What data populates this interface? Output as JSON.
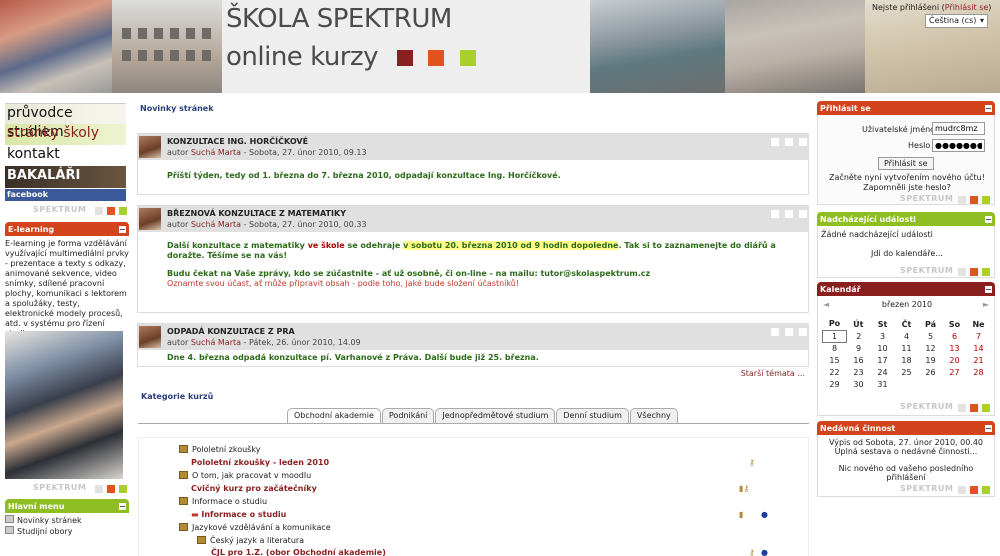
{
  "header": {
    "brand_line1": "ŠKOLA SPEKTRUM",
    "brand_line2": "online kurzy",
    "login_prefix": "Nejste přihlášeni (",
    "login_link": "Přihlásit se",
    "login_suffix": ")",
    "language": "Čeština (cs)",
    "colors": {
      "sq1": "#8a1f1f",
      "sq2": "#e2531f",
      "sq3": "#a9cf2c"
    }
  },
  "left": {
    "nav": [
      "průvodce studiem",
      "stránky školy",
      "kontakt",
      "BAKALÁŘI",
      "facebook"
    ],
    "spectrum": "SPEKTRUM",
    "elearning_title": "E-learning",
    "elearning_text": "E-learning je forma vzdělávání využívající multimediální prvky - prezentace a texty s odkazy, animované sekvence, video snímky, sdílené pracovní plochy, komunikaci s lektorem a spolužáky, testy, elektronické modely procesů, atd. v systému pro řízení studia.",
    "mainmenu_title": "Hlavní menu",
    "mainmenu_items": [
      "Novinky stránek",
      "Studijní obory"
    ]
  },
  "main": {
    "news_title": "Novinky stránek",
    "posts": [
      {
        "title": "KONZULTACE ING. HORČÍČKOVÉ",
        "by": "autor",
        "author": "Suchá Marta",
        "date": " - Sobota, 27. únor 2010, 09.13",
        "body": "Příští týden, tedy od 1. března do 7. března 2010, odpadají konzultace Ing. Horčíčkové."
      },
      {
        "title": "BŘEZNOVÁ KONZULTACE Z MATEMATIKY",
        "by": "autor",
        "author": "Suchá Marta",
        "date": " - Sobota, 27. únor 2010, 00.33",
        "body_a": "Další konzultace z matematiky ",
        "body_b": "ve škole",
        "body_c": " se odehraje ",
        "body_d": "v sobotu 20. března 2010 od 9 hodin dopoledne",
        "body_e": ". Tak si to zaznamenejte do diářů a doražte. Těšíme se na vás!",
        "body2": "Budu čekat na Vaše zprávy, kdo se zúčastnite - ať už osobně, či on-line - na mailu: tutor@skolaspektrum.cz",
        "body3": "Oznamte svou účast, ať může připravit obsah - podle toho, jaké bude složení účastníků!"
      },
      {
        "title": "ODPADÁ KONZULTACE Z PRA",
        "by": "autor",
        "author": "Suchá Marta",
        "date": " - Pátek, 26. únor 2010, 14.09",
        "body": "Dne 4. března odpadá konzultace pí. Varhanové z Práva. Další bude již 25. března."
      }
    ],
    "older": "Starší témata ...",
    "categories_title": "Kategorie kurzů",
    "tabs": [
      "Obchodní akademie",
      "Podnikání",
      "Jednopředmětové studium",
      "Denní studium",
      "Všechny"
    ],
    "cat_rows": [
      {
        "text": "Pololetní zkoušky",
        "course": false
      },
      {
        "text": "Pololetní zkoušky - leden 2010",
        "course": true
      },
      {
        "text": "O tom, jak pracovat v moodlu",
        "course": false
      },
      {
        "text": "Cvičný kurz pro začátečníky",
        "course": true
      },
      {
        "text": "Informace o studiu",
        "course": false
      },
      {
        "text": "Informace o studiu",
        "course": true
      },
      {
        "text": "Jazykové vzdělávání a komunikace",
        "course": false
      },
      {
        "text": "Český jazyk a literatura",
        "course": false
      },
      {
        "text": "ČJL pro 1.Z. (obor Obchodní akademie)",
        "course": true
      }
    ]
  },
  "right": {
    "login_title": "Přihlásit se",
    "user_label": "Uživatelské jméno",
    "user_value": "mudrc8mz",
    "pass_label": "Heslo",
    "pass_value": "●●●●●●●",
    "login_button": "Přihlásit se",
    "create_account": "Začněte nyní vytvořením nového účtu!",
    "forgot": "Zapomněli jste heslo?",
    "events_title": "Nadcházející události",
    "events_text": "Žádné nadcházející události",
    "events_link": "Jdi do kalendáře...",
    "calendar_title": "Kalendář",
    "month": "březen 2010",
    "prev": "◄",
    "next": "►",
    "days": [
      "Po",
      "Út",
      "St",
      "Čt",
      "Pá",
      "So",
      "Ne"
    ],
    "weeks": [
      [
        "1",
        "2",
        "3",
        "4",
        "5",
        "6",
        "7"
      ],
      [
        "8",
        "9",
        "10",
        "11",
        "12",
        "13",
        "14"
      ],
      [
        "15",
        "16",
        "17",
        "18",
        "19",
        "20",
        "21"
      ],
      [
        "22",
        "23",
        "24",
        "25",
        "26",
        "27",
        "28"
      ],
      [
        "29",
        "30",
        "31",
        "",
        "",
        "",
        ""
      ]
    ],
    "activity_title": "Nedávná činnost",
    "activity_line1": "Výpis od Sobota, 27. únor 2010, 00.40",
    "activity_line2": "Úplná sestava o nedávné činnosti...",
    "activity_line3": "Nic nového od vašeho posledního přihlášení"
  }
}
